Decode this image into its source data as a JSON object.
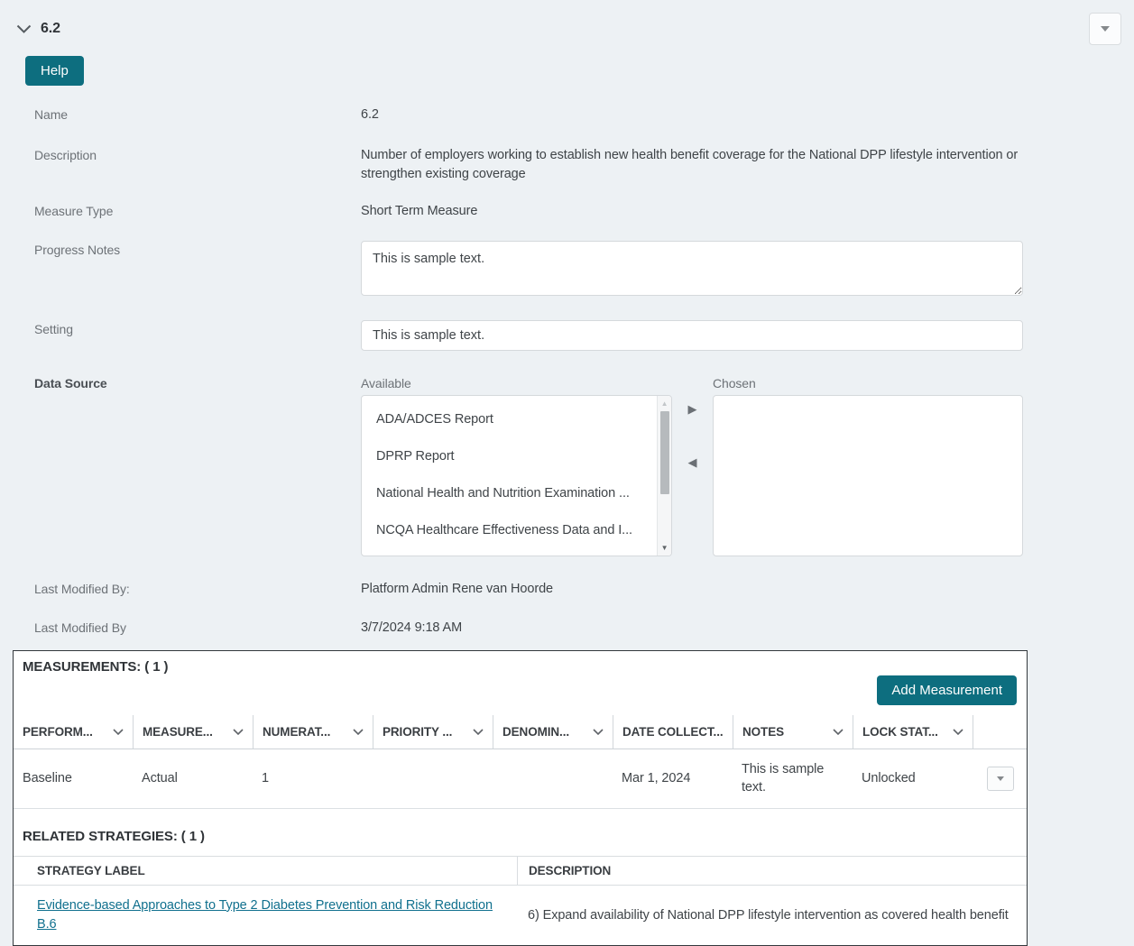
{
  "header": {
    "title": "6.2"
  },
  "toolbar": {
    "help_label": "Help"
  },
  "form": {
    "name": {
      "label": "Name",
      "value": "6.2"
    },
    "description": {
      "label": "Description",
      "value": "Number of employers working to establish new health benefit coverage for the National DPP lifestyle intervention or strengthen existing coverage"
    },
    "measure_type": {
      "label": "Measure Type",
      "value": "Short Term Measure"
    },
    "progress_notes": {
      "label": "Progress Notes",
      "value": "This is sample text."
    },
    "setting": {
      "label": "Setting",
      "value": "This is sample text."
    },
    "data_source": {
      "label": "Data Source",
      "available_label": "Available",
      "chosen_label": "Chosen",
      "available_items": [
        "ADA/ADCES Report",
        "DPRP Report",
        "National Health and Nutrition Examination ...",
        "NCQA Healthcare Effectiveness Data and I..."
      ],
      "chosen_items": []
    },
    "last_modified_by_user": {
      "label": "Last Modified By:",
      "value": "Platform Admin Rene van Hoorde"
    },
    "last_modified_date": {
      "label": "Last Modified By",
      "value": "3/7/2024 9:18 AM"
    }
  },
  "measurements": {
    "section_title": "MEASUREMENTS: ( 1 )",
    "add_button_label": "Add Measurement",
    "columns": [
      "PERFORM...",
      "MEASURE...",
      "NUMERAT...",
      "PRIORITY ...",
      "DENOMIN...",
      "DATE COLLECT...",
      "NOTES",
      "LOCK STAT..."
    ],
    "rows": [
      {
        "performance": "Baseline",
        "measure": "Actual",
        "numerator": "1",
        "priority": "",
        "denominator": "",
        "date_collected": "Mar 1, 2024",
        "notes": "This is sample text.",
        "lock_status": "Unlocked"
      }
    ]
  },
  "related_strategies": {
    "section_title": "RELATED STRATEGIES: ( 1 )",
    "columns": [
      "STRATEGY LABEL",
      "DESCRIPTION"
    ],
    "rows": [
      {
        "strategy_label": "Evidence-based Approaches to Type 2 Diabetes Prevention and Risk Reduction B.6",
        "description": "6) Expand availability of National DPP lifestyle intervention as covered health benefit"
      }
    ]
  },
  "colors": {
    "accent_teal": "#0d6e7f",
    "link": "#10708e",
    "background": "#edf1f4",
    "panel_border": "#33383c"
  }
}
